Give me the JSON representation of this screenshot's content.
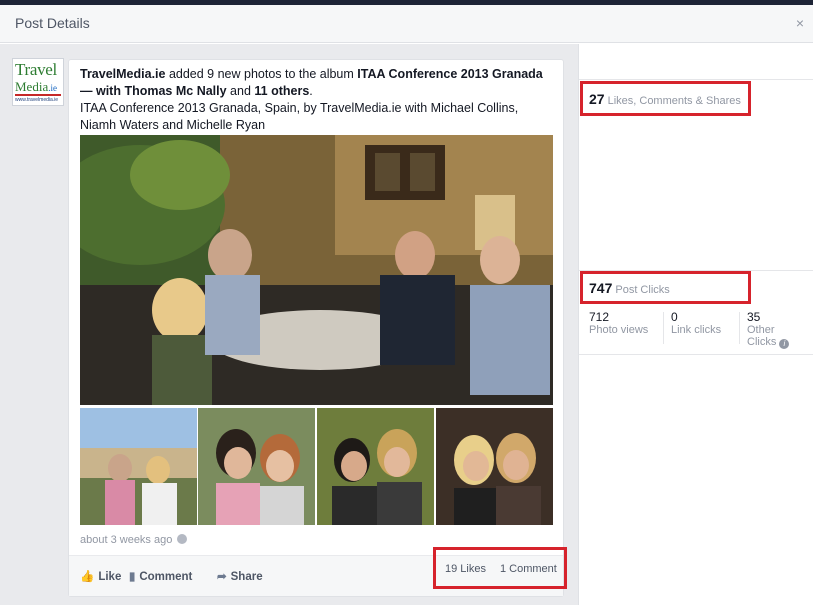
{
  "dialog": {
    "title": "Post Details",
    "close_glyph": "×"
  },
  "post": {
    "page_name": "TravelMedia.ie",
    "logo": {
      "line1": "Travel",
      "line2": "Media",
      "line2_suffix": ".ie",
      "url": "www.travelmedia.ie"
    },
    "story_mid": " added 9 new photos to the album ",
    "album_title": "ITAA Conference 2013 Granada",
    "with_text": " — with ",
    "tagged_person": "Thomas Mc Nally",
    "and_text": " and ",
    "others": "11 others",
    "end_period": ".",
    "description": "ITAA Conference 2013 Granada, Spain, by TravelMedia.ie with Michael Collins, Niamh Waters and Michelle Ryan",
    "timestamp": "about 3 weeks ago"
  },
  "actions": {
    "like_label": "Like",
    "comment_label": "Comment",
    "share_label": "Share",
    "likes_count": "19 Likes",
    "comments_count": "1 Comment"
  },
  "insights": {
    "engagement_count": "27",
    "engagement_label": "Likes, Comments & Shares",
    "clicks_count": "747",
    "clicks_label": "Post Clicks",
    "photo_views_count": "712",
    "photo_views_label": "Photo views",
    "link_clicks_count": "0",
    "link_clicks_label": "Link clicks",
    "other_clicks_count": "35",
    "other_clicks_label_line1": "Other",
    "other_clicks_label_line2": "Clicks",
    "info_glyph": "i"
  },
  "colors": {
    "highlight_red": "#d6232c",
    "link_blue": "#3b5998",
    "muted_grey": "#9197a3"
  },
  "icons": [
    "close-icon",
    "thumbs-up-icon",
    "comment-icon",
    "share-arrow-icon",
    "globe-icon",
    "info-icon"
  ]
}
